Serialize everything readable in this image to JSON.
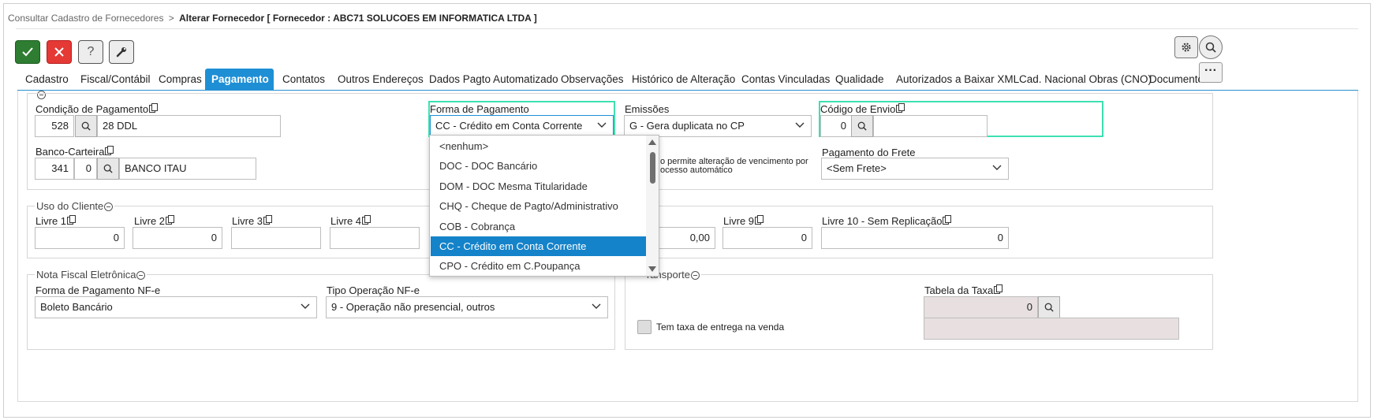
{
  "breadcrumb": {
    "parent": "Consultar Cadastro de Fornecedores",
    "separator": ">",
    "current": "Alterar Fornecedor [ Fornecedor : ABC71 SOLUCOES EM INFORMATICA LTDA ]"
  },
  "toolbar": {
    "help_label": "?"
  },
  "tabs": [
    "Cadastro",
    "Fiscal/Contábil",
    "Compras",
    "Pagamento",
    "Contatos",
    "Outros Endereços",
    "Dados Pagto Automatizado",
    "Observações",
    "Histórico de Alteração",
    "Contas Vinculadas",
    "Qualidade",
    "Autorizados a Baixar XML",
    "Cad. Nacional Obras (CNO)",
    "Documentos"
  ],
  "active_tab": "Pagamento",
  "pagamento": {
    "condicao_label": "Condição de Pagamento",
    "condicao_code": "528",
    "condicao_desc": "28 DDL",
    "forma_label": "Forma de Pagamento",
    "forma_value": "CC - Crédito em Conta Corrente",
    "emissoes_label": "Emissões",
    "emissoes_value": "G - Gera duplicata no CP",
    "codigo_envio_label": "Código de Envio",
    "codigo_envio_value": "0",
    "banco_label": "Banco-Carteira",
    "banco_code": "341",
    "carteira_code": "0",
    "banco_desc": "BANCO ITAU",
    "vencimento_text_1": "o permite alteração de vencimento por",
    "vencimento_text_2": "ocesso automático",
    "frete_label": "Pagamento do Frete",
    "frete_value": "<Sem Frete>"
  },
  "uso_cliente": {
    "title": "Uso do Cliente",
    "fields": [
      {
        "label": "Livre 1",
        "value": "0"
      },
      {
        "label": "Livre 2",
        "value": "0"
      },
      {
        "label": "Livre 3",
        "value": ""
      },
      {
        "label": "Livre 4",
        "value": ""
      },
      {
        "label": "",
        "value": "0,00"
      },
      {
        "label": "Livre 9",
        "value": "0"
      },
      {
        "label": "Livre 10 - Sem Replicação",
        "value": "0"
      }
    ]
  },
  "nfe": {
    "title": "Nota Fiscal Eletrônica",
    "forma_label": "Forma de Pagamento NF-e",
    "forma_value": "Boleto Bancário",
    "tipo_label": "Tipo Operação NF-e",
    "tipo_value": "9 - Operação não presencial, outros"
  },
  "transporte": {
    "title": "ransporte",
    "tabela_label": "Tabela da Taxa",
    "tabela_value": "0",
    "taxa_label": "Tem taxa de entrega na venda"
  },
  "dropdown_options": [
    "<nenhum>",
    "DOC - DOC Bancário",
    "DOM - DOC Mesma Titularidade",
    "CHQ - Cheque de Pagto/Administrativo",
    "COB - Cobrança",
    "CC - Crédito em Conta Corrente",
    "CPO - Crédito em C.Poupança"
  ],
  "dropdown_selected_index": 5,
  "colors": {
    "accent": "#1e8fd5",
    "confirm": "#2e7d32",
    "cancel": "#e53935",
    "highlight": "#3de0b0"
  }
}
